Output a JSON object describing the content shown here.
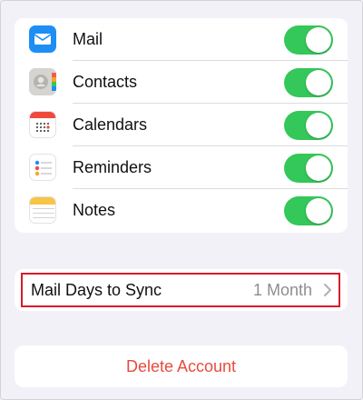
{
  "sync_list": {
    "items": [
      {
        "label": "Mail",
        "icon": "mail-icon",
        "enabled": true
      },
      {
        "label": "Contacts",
        "icon": "contacts-icon",
        "enabled": true
      },
      {
        "label": "Calendars",
        "icon": "calendar-icon",
        "enabled": true
      },
      {
        "label": "Reminders",
        "icon": "reminders-icon",
        "enabled": true
      },
      {
        "label": "Notes",
        "icon": "notes-icon",
        "enabled": true
      }
    ]
  },
  "mail_days": {
    "label": "Mail Days to Sync",
    "value": "1 Month",
    "chevron_icon": "chevron-right-icon"
  },
  "delete_account": {
    "label": "Delete Account"
  },
  "colors": {
    "toggle_on": "#34c759",
    "destructive": "#e74c3c",
    "highlight": "#d81b2b"
  }
}
